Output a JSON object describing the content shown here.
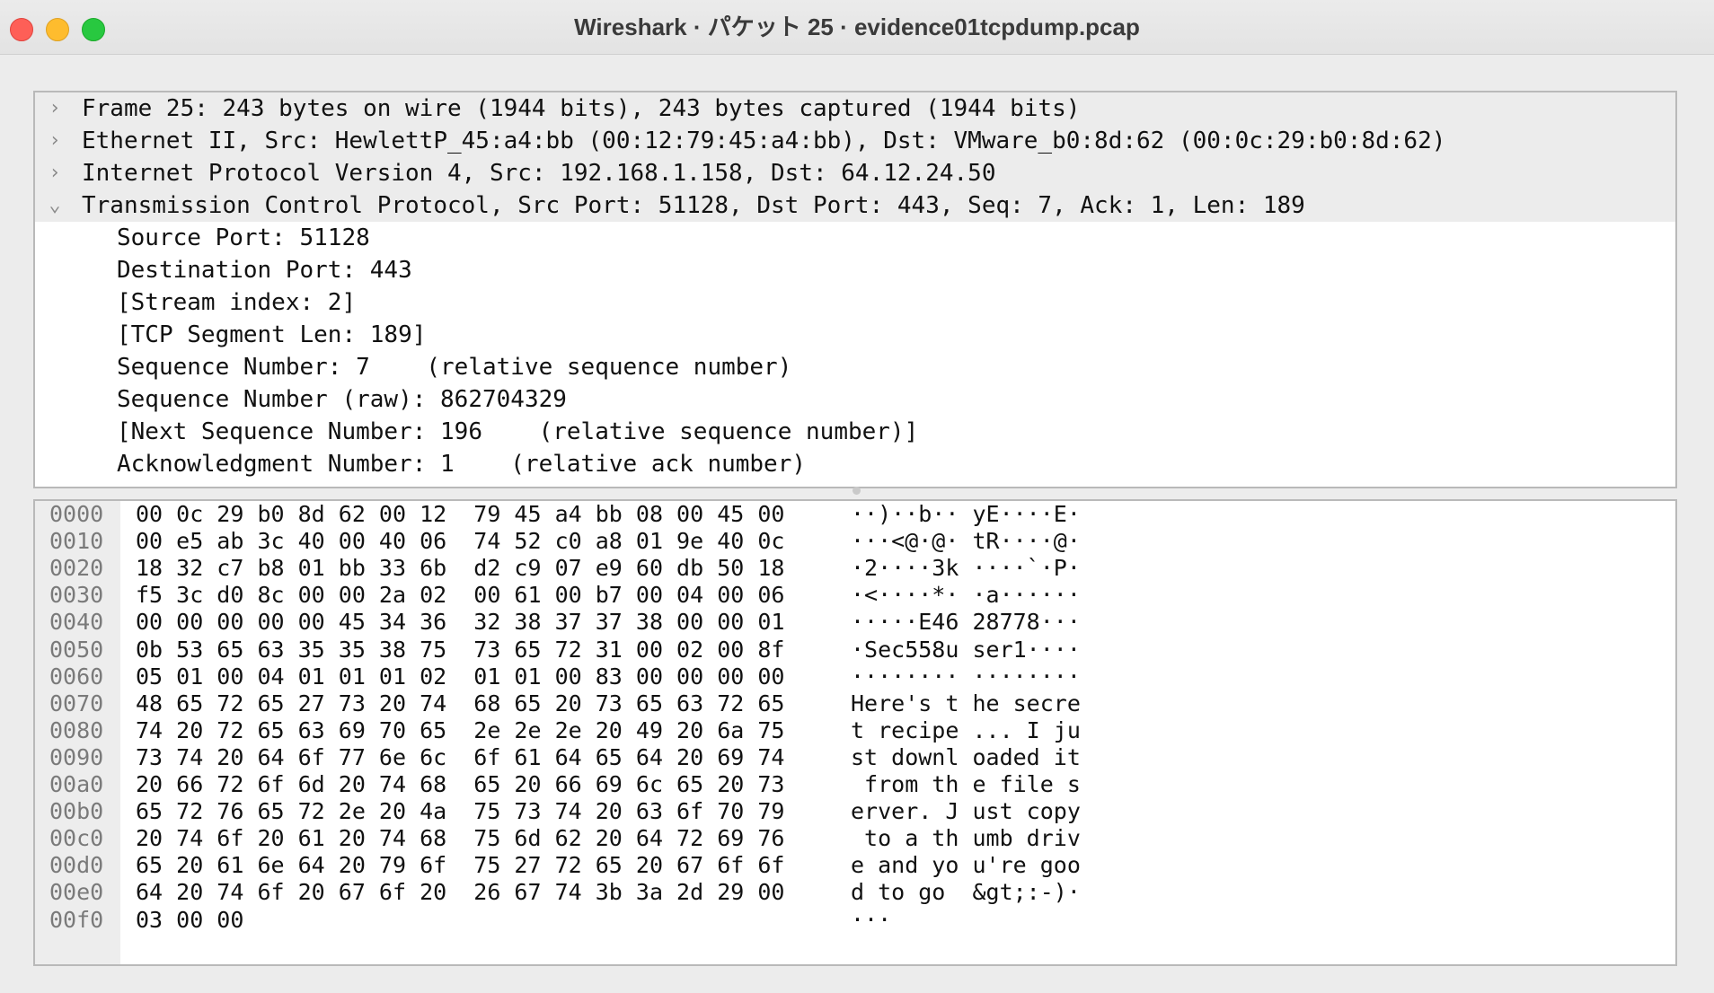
{
  "window": {
    "title": "Wireshark · パケット 25 · evidence01tcpdump.pcap"
  },
  "icons": {
    "collapsed": "chevron-right-icon",
    "expanded": "chevron-down-icon"
  },
  "detail": {
    "rows": [
      {
        "text": "Frame 25: 243 bytes on wire (1944 bits), 243 bytes captured (1944 bits)",
        "expandable": true,
        "expanded": false,
        "chevron": "›"
      },
      {
        "text": "Ethernet II, Src: HewlettP_45:a4:bb (00:12:79:45:a4:bb), Dst: VMware_b0:8d:62 (00:0c:29:b0:8d:62)",
        "expandable": true,
        "expanded": false,
        "chevron": "›"
      },
      {
        "text": "Internet Protocol Version 4, Src: 192.168.1.158, Dst: 64.12.24.50",
        "expandable": true,
        "expanded": false,
        "chevron": "›"
      },
      {
        "text": "Transmission Control Protocol, Src Port: 51128, Dst Port: 443, Seq: 7, Ack: 1, Len: 189",
        "expandable": true,
        "expanded": true,
        "chevron": "⌄"
      },
      {
        "text": "Source Port: 51128",
        "expandable": false
      },
      {
        "text": "Destination Port: 443",
        "expandable": false
      },
      {
        "text": "[Stream index: 2]",
        "expandable": false
      },
      {
        "text": "[TCP Segment Len: 189]",
        "expandable": false
      },
      {
        "text": "Sequence Number: 7    (relative sequence number)",
        "expandable": false
      },
      {
        "text": "Sequence Number (raw): 862704329",
        "expandable": false
      },
      {
        "text": "[Next Sequence Number: 196    (relative sequence number)]",
        "expandable": false
      },
      {
        "text": "Acknowledgment Number: 1    (relative ack number)",
        "expandable": false
      }
    ]
  },
  "hex": {
    "rows": [
      {
        "offset": "0000",
        "bytes": "00 0c 29 b0 8d 62 00 12  79 45 a4 bb 08 00 45 00",
        "ascii": "··)··b·· yE····E·"
      },
      {
        "offset": "0010",
        "bytes": "00 e5 ab 3c 40 00 40 06  74 52 c0 a8 01 9e 40 0c",
        "ascii": "···<@·@· tR····@·"
      },
      {
        "offset": "0020",
        "bytes": "18 32 c7 b8 01 bb 33 6b  d2 c9 07 e9 60 db 50 18",
        "ascii": "·2····3k ····`·P·"
      },
      {
        "offset": "0030",
        "bytes": "f5 3c d0 8c 00 00 2a 02  00 61 00 b7 00 04 00 06",
        "ascii": "·<····*· ·a······"
      },
      {
        "offset": "0040",
        "bytes": "00 00 00 00 00 45 34 36  32 38 37 37 38 00 00 01",
        "ascii": "·····E46 28778···"
      },
      {
        "offset": "0050",
        "bytes": "0b 53 65 63 35 35 38 75  73 65 72 31 00 02 00 8f",
        "ascii": "·Sec558u ser1····"
      },
      {
        "offset": "0060",
        "bytes": "05 01 00 04 01 01 01 02  01 01 00 83 00 00 00 00",
        "ascii": "········ ········"
      },
      {
        "offset": "0070",
        "bytes": "48 65 72 65 27 73 20 74  68 65 20 73 65 63 72 65",
        "ascii": "Here's t he secre"
      },
      {
        "offset": "0080",
        "bytes": "74 20 72 65 63 69 70 65  2e 2e 2e 20 49 20 6a 75",
        "ascii": "t recipe ... I ju"
      },
      {
        "offset": "0090",
        "bytes": "73 74 20 64 6f 77 6e 6c  6f 61 64 65 64 20 69 74",
        "ascii": "st downl oaded it"
      },
      {
        "offset": "00a0",
        "bytes": "20 66 72 6f 6d 20 74 68  65 20 66 69 6c 65 20 73",
        "ascii": " from th e file s"
      },
      {
        "offset": "00b0",
        "bytes": "65 72 76 65 72 2e 20 4a  75 73 74 20 63 6f 70 79",
        "ascii": "erver. J ust copy"
      },
      {
        "offset": "00c0",
        "bytes": "20 74 6f 20 61 20 74 68  75 6d 62 20 64 72 69 76",
        "ascii": " to a th umb driv"
      },
      {
        "offset": "00d0",
        "bytes": "65 20 61 6e 64 20 79 6f  75 27 72 65 20 67 6f 6f",
        "ascii": "e and yo u're goo"
      },
      {
        "offset": "00e0",
        "bytes": "64 20 74 6f 20 67 6f 20  26 67 74 3b 3a 2d 29 00",
        "ascii": "d to go  &gt;:-)·"
      },
      {
        "offset": "00f0",
        "bytes": "03 00 00",
        "ascii": "···"
      }
    ]
  }
}
